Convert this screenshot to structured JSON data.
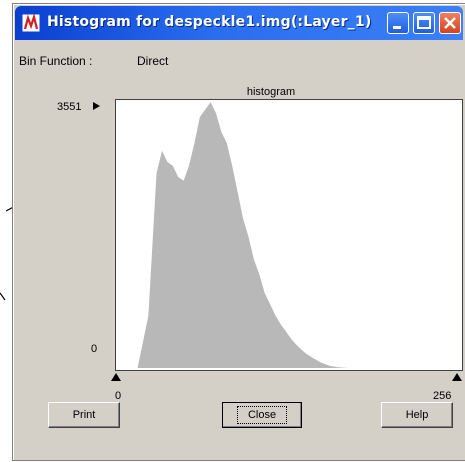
{
  "window": {
    "title": "Histogram for despeckle1.img(:Layer_1)"
  },
  "bin_function": {
    "label": "Bin Function :",
    "value": "Direct"
  },
  "histogram": {
    "title": "histogram",
    "y_max_label": "3551",
    "y_min_label": "0",
    "x_min_label": "0",
    "x_max_label": "256",
    "fill_color": "#b8b8b8"
  },
  "chart_data": {
    "type": "area",
    "x": [
      0,
      16,
      24,
      30,
      34,
      38,
      42,
      46,
      50,
      54,
      58,
      62,
      66,
      70,
      74,
      78,
      82,
      86,
      90,
      94,
      98,
      102,
      106,
      110,
      114,
      118,
      122,
      126,
      130,
      134,
      140,
      146,
      152,
      158,
      164,
      172,
      180,
      256
    ],
    "values": [
      0,
      0,
      700,
      2600,
      2900,
      2750,
      2700,
      2550,
      2500,
      2700,
      3000,
      3350,
      3450,
      3550,
      3400,
      3150,
      3000,
      2700,
      2350,
      2000,
      1750,
      1450,
      1250,
      1000,
      850,
      700,
      580,
      480,
      380,
      300,
      200,
      130,
      70,
      30,
      10,
      0,
      0,
      0
    ],
    "xlim": [
      0,
      256
    ],
    "ylim": [
      0,
      3551
    ]
  },
  "buttons": {
    "print": "Print",
    "close": "Close",
    "help": "Help"
  }
}
